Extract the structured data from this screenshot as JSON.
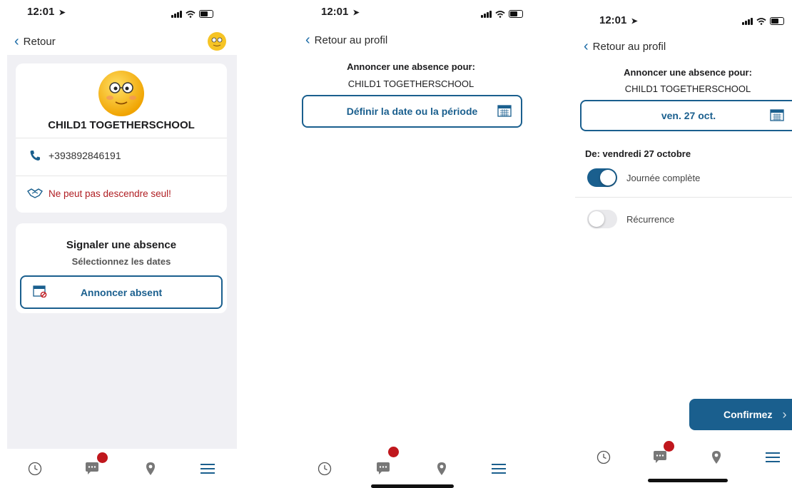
{
  "status": {
    "time": "12:01",
    "arrow": "➤"
  },
  "screen1": {
    "back_label": "Retour",
    "child_name": "CHILD1 TOGETHERSCHOOL",
    "phone": "+393892846191",
    "warning": "Ne peut pas descendre seul!",
    "absence_title": "Signaler une absence",
    "absence_subtitle": "Sélectionnez les dates",
    "announce_button": "Annoncer absent"
  },
  "screen2": {
    "back_label": "Retour au profil",
    "heading": "Annoncer une absence pour:",
    "child_name": "CHILD1 TOGETHERSCHOOL",
    "date_button": "Définir la date ou la période"
  },
  "screen3": {
    "back_label": "Retour au profil",
    "heading": "Annoncer une absence pour:",
    "child_name": "CHILD1 TOGETHERSCHOOL",
    "date_value": "ven. 27 oct.",
    "from_label": "De: vendredi 27 octobre",
    "full_day_label": "Journée complète",
    "full_day_on": true,
    "recurrence_label": "Récurrence",
    "recurrence_on": false,
    "confirm_button": "Confirmez"
  },
  "tabs": [
    "clock-icon",
    "chat-icon",
    "location-pin-icon",
    "menu-icon"
  ],
  "colors": {
    "accent": "#1a5f8e",
    "badge": "#c0171d",
    "warning_text": "#b01e23"
  }
}
